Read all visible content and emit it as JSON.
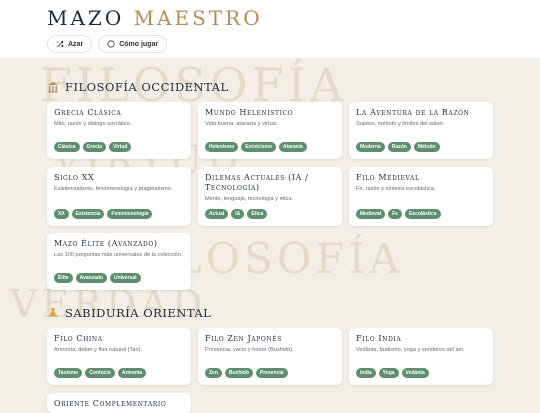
{
  "app": {
    "logo_word1": "MAZO",
    "logo_word2": "MAESTRO"
  },
  "toolbar": {
    "random_label": "Azar",
    "howto_label": "Cómo jugar"
  },
  "background_words": [
    "FILOSOFÍA",
    "VIRTUD",
    "FILOSOFÍA",
    "VERDAD"
  ],
  "sections": [
    {
      "title": "FILOSOFÍA OCCIDENTAL",
      "icon": "temple-icon",
      "cards": [
        {
          "title": "Grecia Clásica",
          "desc": "Mito, razón y diálogo socrático.",
          "tags": [
            "Clásica",
            "Grecia",
            "Virtud"
          ]
        },
        {
          "title": "Mundo Helenístico",
          "desc": "Vida buena: ataraxia y virtud.",
          "tags": [
            "Helenismo",
            "Estoicismo",
            "Ataraxia"
          ]
        },
        {
          "title": "La Aventura de la Razón",
          "desc": "Sujetos, método y límites del saber.",
          "tags": [
            "Moderna",
            "Razón",
            "Método"
          ]
        },
        {
          "title": "Siglo XX",
          "desc": "Existencialismo, fenomenología y pragmatismo.",
          "tags": [
            "XX",
            "Existencia",
            "Fenomenología"
          ]
        },
        {
          "title": "Dilemas Actuales (IA / Tecnología)",
          "desc": "Mente, lenguaje, tecnología y ética.",
          "tags": [
            "Actual",
            "IA",
            "Ética"
          ]
        },
        {
          "title": "Filo Medieval",
          "desc": "Fe, razón y síntesis escolástica.",
          "tags": [
            "Medieval",
            "Fe",
            "Escolástica"
          ]
        },
        {
          "title": "Mazo Élite (Avanzado)",
          "desc": "Las 100 preguntas más universales de la colección.",
          "tags": [
            "Élite",
            "Avanzado",
            "Universal"
          ]
        }
      ]
    },
    {
      "title": "SABIDURÍA ORIENTAL",
      "icon": "meditation-icon",
      "cards": [
        {
          "title": "Filo China",
          "desc": "Armonía, deber y fluir natural (Tao).",
          "tags": [
            "Taoísmo",
            "Confucio",
            "Armonía"
          ]
        },
        {
          "title": "Filo Zen Japonés",
          "desc": "Presencia, vacío y honor (Bushidō).",
          "tags": [
            "Zen",
            "Bushidō",
            "Presencia"
          ]
        },
        {
          "title": "Filo India",
          "desc": "Vedānta, budismo, yoga y senderos del ser.",
          "tags": [
            "India",
            "Yoga",
            "Vedānta"
          ]
        },
        {
          "title": "Oriente Complementario",
          "desc": "",
          "tags": []
        }
      ]
    }
  ],
  "colors": {
    "accent_gold": "#b08d5a",
    "tag_green": "#5e8e6f",
    "navy": "#1f2a3a"
  }
}
